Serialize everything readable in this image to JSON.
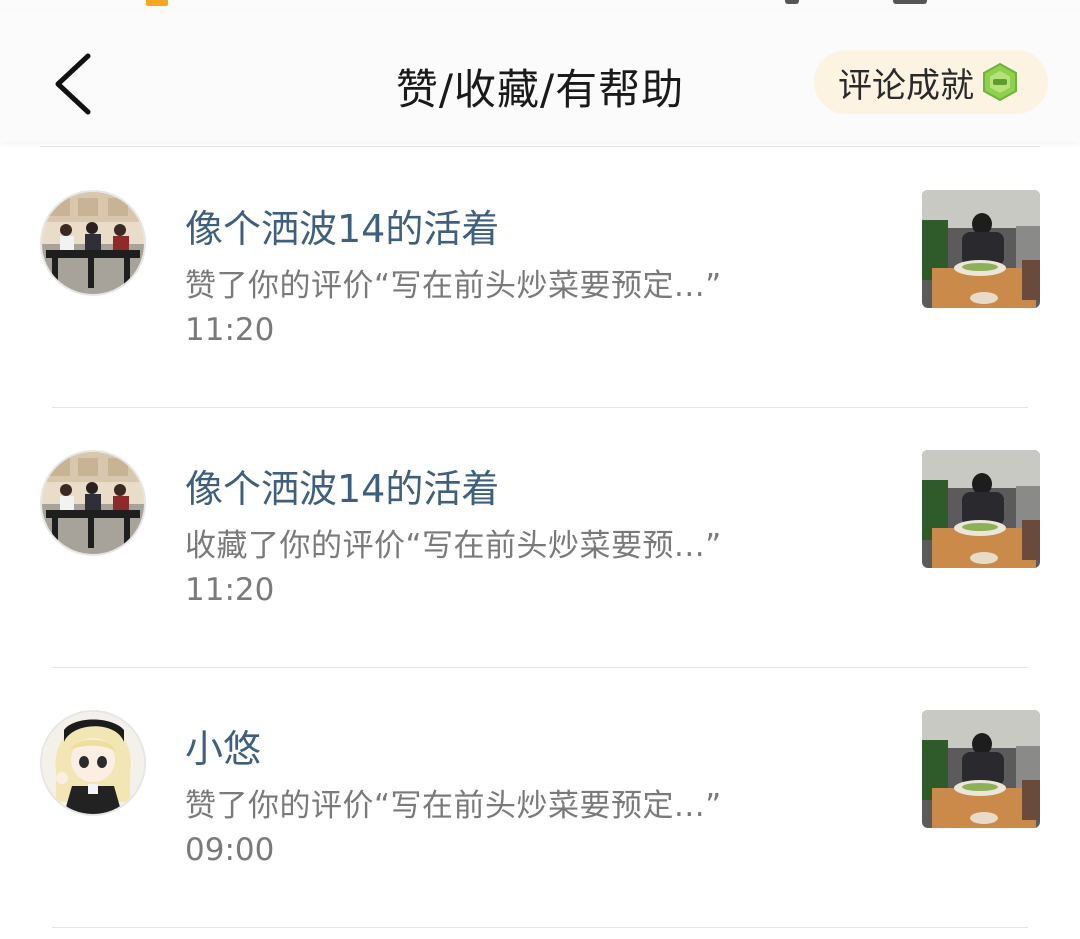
{
  "header": {
    "title": "赞/收藏/有帮助",
    "achievement_label": "评论成就"
  },
  "notifications": [
    {
      "name": "像个洒波14的活着",
      "text": "赞了你的评价“写在前头炒菜要预定...”",
      "time": "11:20",
      "avatar": "classroom-photo",
      "thumbnail": "dinner-photo"
    },
    {
      "name": "像个洒波14的活着",
      "text": "收藏了你的评价“写在前头炒菜要预...”",
      "time": "11:20",
      "avatar": "classroom-photo",
      "thumbnail": "dinner-photo"
    },
    {
      "name": "小悠",
      "text": "赞了你的评价“写在前头炒菜要预定...”",
      "time": "09:00",
      "avatar": "anime-girl",
      "thumbnail": "dinner-photo"
    }
  ],
  "colors": {
    "name": "#3f5f7e",
    "secondary_text": "#7a7a7a",
    "achievement_bg": "#fdf3e3",
    "gem": "#8fd14f"
  }
}
